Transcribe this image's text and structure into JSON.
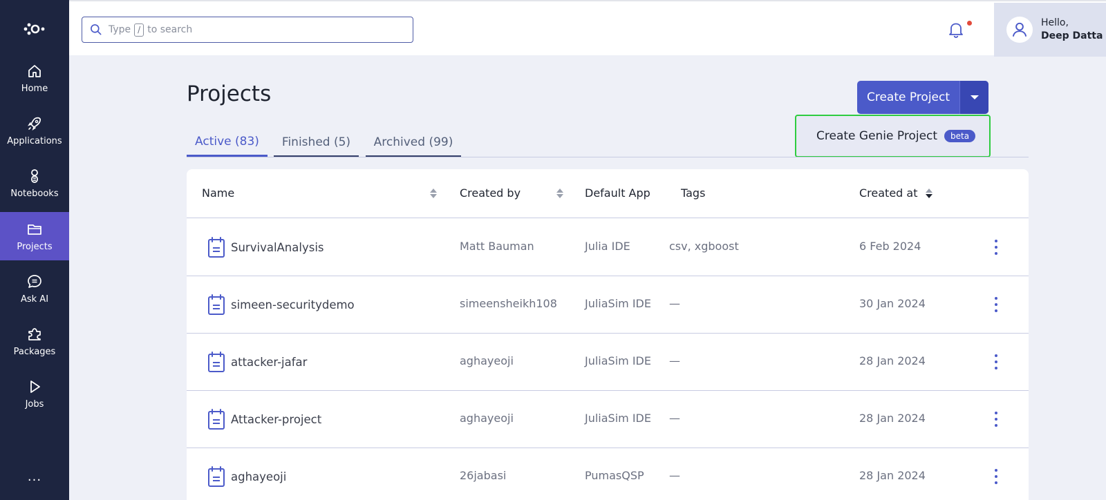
{
  "sidebar": {
    "logo_icon": "logo-icon",
    "items": [
      {
        "label": "Home",
        "icon": "home-icon"
      },
      {
        "label": "Applications",
        "icon": "rocket-icon"
      },
      {
        "label": "Notebooks",
        "icon": "notebook-icon"
      },
      {
        "label": "Projects",
        "icon": "folder-icon",
        "active": true
      },
      {
        "label": "Ask AI",
        "icon": "chat-icon"
      },
      {
        "label": "Packages",
        "icon": "puzzle-icon"
      },
      {
        "label": "Jobs",
        "icon": "play-icon"
      }
    ],
    "more": "..."
  },
  "search": {
    "prefix": "Type",
    "shortcut": "/",
    "suffix": "to search"
  },
  "user": {
    "greeting": "Hello,",
    "name": "Deep Datta"
  },
  "page": {
    "title": "Projects",
    "create_button": "Create Project",
    "dropdown_item": "Create Genie Project",
    "dropdown_badge": "beta"
  },
  "tabs": [
    {
      "label": "Active (83)",
      "active": true
    },
    {
      "label": "Finished (5)"
    },
    {
      "label": "Archived (99)"
    }
  ],
  "table": {
    "columns": [
      "Name",
      "Created by",
      "Default App",
      "Tags",
      "Created at"
    ],
    "rows": [
      {
        "name": "SurvivalAnalysis",
        "created_by": "Matt Bauman",
        "default_app": "Julia IDE",
        "tags": "csv, xgboost",
        "created_at": "6 Feb 2024"
      },
      {
        "name": "simeen-securitydemo",
        "created_by": "simeensheikh108",
        "default_app": "JuliaSim IDE",
        "tags": "—",
        "created_at": "30 Jan 2024"
      },
      {
        "name": "attacker-jafar",
        "created_by": "aghayeoji",
        "default_app": "JuliaSim IDE",
        "tags": "—",
        "created_at": "28 Jan 2024"
      },
      {
        "name": "Attacker-project",
        "created_by": "aghayeoji",
        "default_app": "JuliaSim IDE",
        "tags": "—",
        "created_at": "28 Jan 2024"
      },
      {
        "name": "aghayeoji",
        "created_by": "26jabasi",
        "default_app": "PumasQSP",
        "tags": "—",
        "created_at": "28 Jan 2024"
      }
    ]
  },
  "colors": {
    "sidebar_bg": "#1d2540",
    "sidebar_active": "#5c52c6",
    "accent": "#4b5ac9",
    "highlight_border": "#2ecc3f"
  }
}
